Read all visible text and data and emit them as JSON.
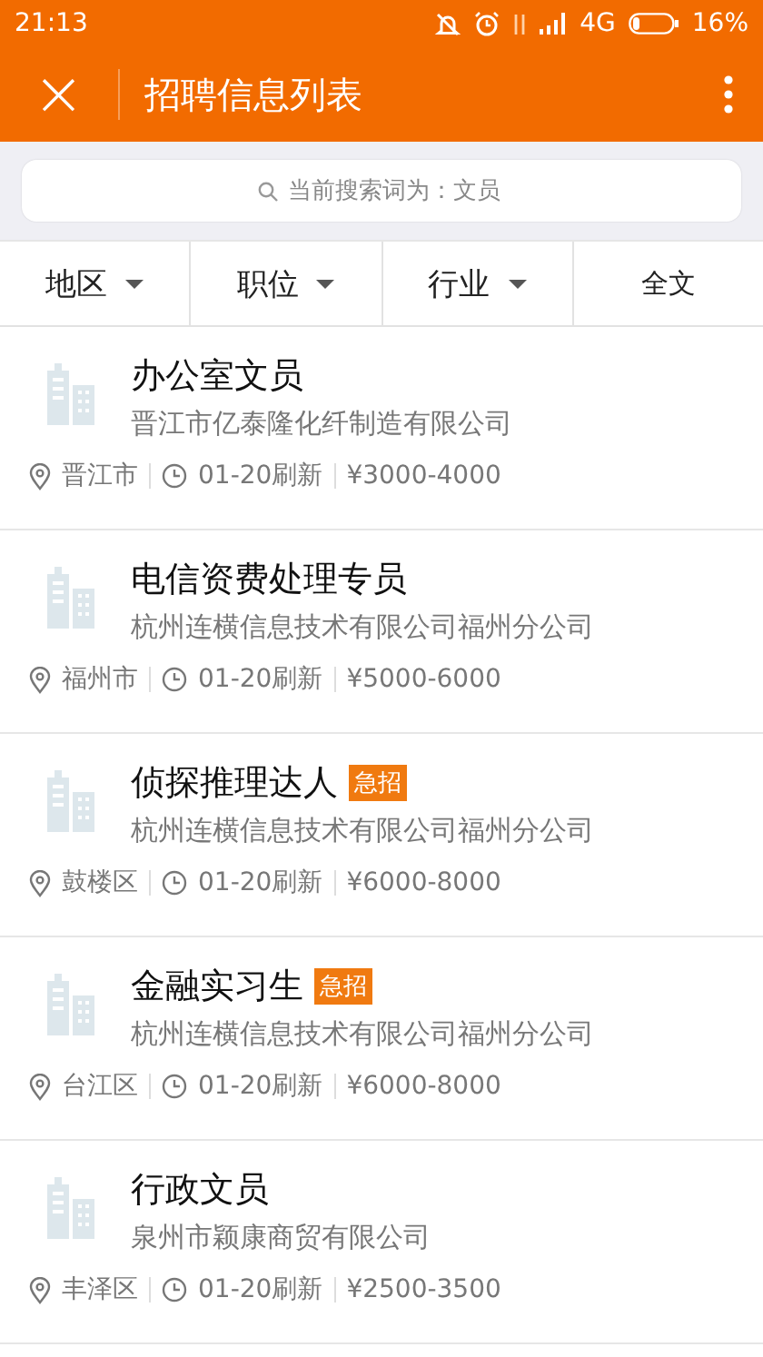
{
  "status_bar": {
    "time": "21:13",
    "network": "4G",
    "battery": "16%"
  },
  "app_bar": {
    "close": "×",
    "title": "招聘信息列表"
  },
  "search": {
    "placeholder": "当前搜索词为：文员"
  },
  "filters": [
    {
      "label": "地区",
      "kind": "dropdown"
    },
    {
      "label": "职位",
      "kind": "dropdown"
    },
    {
      "label": "行业",
      "kind": "dropdown"
    },
    {
      "label": "全文",
      "kind": "plain"
    }
  ],
  "jobs": [
    {
      "title": "办公室文员",
      "company": "晋江市亿泰隆化纤制造有限公司",
      "location": "晋江市",
      "refreshed": "01-20刷新",
      "salary": "¥3000-4000"
    },
    {
      "title": "电信资费处理专员",
      "company": "杭州连横信息技术有限公司福州分公司",
      "location": "福州市",
      "refreshed": "01-20刷新",
      "salary": "¥5000-6000"
    },
    {
      "title": "侦探推理达人",
      "badge": "急招",
      "company": "杭州连横信息技术有限公司福州分公司",
      "location": "鼓楼区",
      "refreshed": "01-20刷新",
      "salary": "¥6000-8000"
    },
    {
      "title": "金融实习生",
      "badge": "急招",
      "company": "杭州连横信息技术有限公司福州分公司",
      "location": "台江区",
      "refreshed": "01-20刷新",
      "salary": "¥6000-8000"
    },
    {
      "title": "行政文员",
      "company": "泉州市颖康商贸有限公司",
      "location": "丰泽区",
      "refreshed": "01-20刷新",
      "salary": "¥2500-3500"
    }
  ]
}
